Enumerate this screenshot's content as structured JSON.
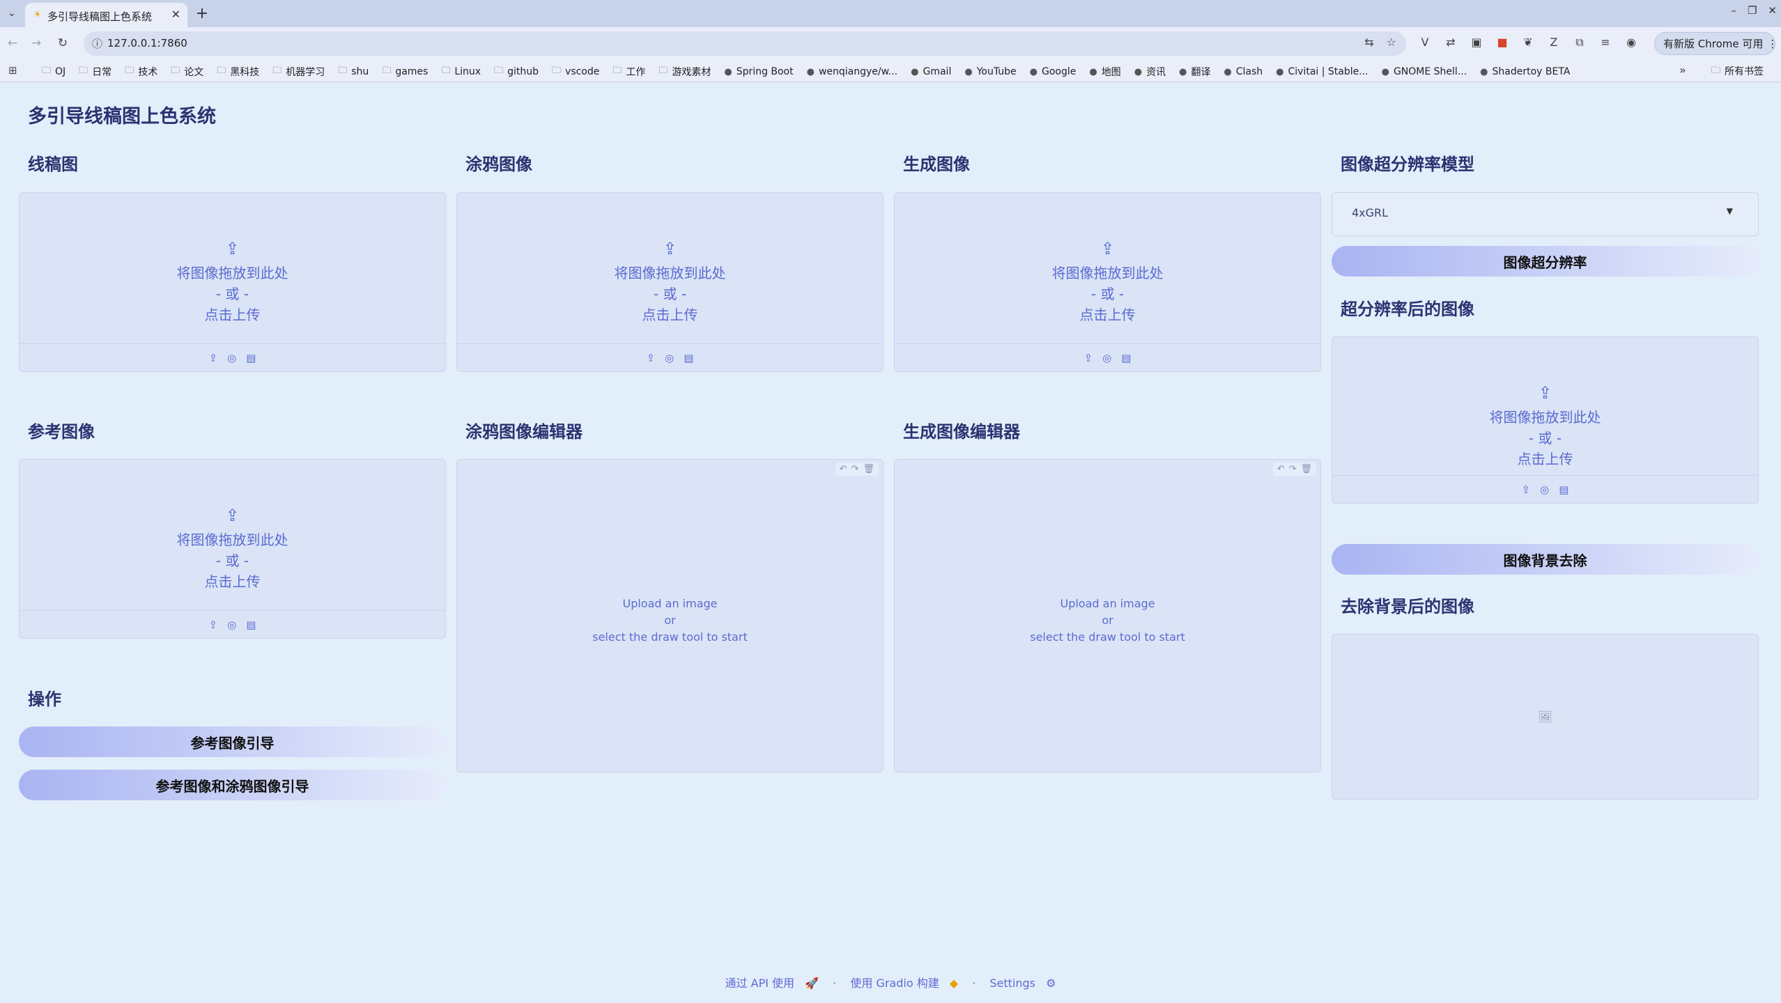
{
  "browser": {
    "tab_title": "多引导线稿图上色系统",
    "url": "127.0.0.1:7860",
    "update_button": "有新版 Chrome 可用",
    "bookmarks": [
      "OJ",
      "日常",
      "技术",
      "论文",
      "黑科技",
      "机器学习",
      "shu",
      "games",
      "Linux",
      "github",
      "vscode",
      "工作",
      "游戏素材",
      "Spring Boot",
      "wenqiangye/w...",
      "Gmail",
      "YouTube",
      "Google",
      "地图",
      "资讯",
      "翻译",
      "Clash",
      "Civitai | Stable...",
      "GNOME Shell...",
      "Shadertoy BETA"
    ],
    "all_bookmarks": "所有书签"
  },
  "app": {
    "title": "多引导线稿图上色系统",
    "sections": {
      "lineart": "线稿图",
      "scribble": "涂鸦图像",
      "generated": "生成图像",
      "sr_model": "图像超分辨率模型",
      "reference": "参考图像",
      "scribble_editor": "涂鸦图像编辑器",
      "generated_editor": "生成图像编辑器",
      "sr_result": "超分辨率后的图像",
      "actions": "操作",
      "bg_removed": "去除背景后的图像"
    },
    "upload": {
      "line1": "将图像拖放到此处",
      "line2": "- 或 -",
      "line3": "点击上传"
    },
    "editor": {
      "line1": "Upload an image",
      "line2": "or",
      "line3": "select the draw tool to start"
    },
    "sr_model_value": "4xGRL",
    "buttons": {
      "super_resolution": "图像超分辨率",
      "remove_bg": "图像背景去除",
      "ref_guide": "参考图像引导",
      "ref_scribble_guide": "参考图像和涂鸦图像引导"
    },
    "footer": {
      "api": "通过 API 使用",
      "gradio": "使用 Gradio 构建",
      "settings": "Settings",
      "sep": "·"
    }
  }
}
